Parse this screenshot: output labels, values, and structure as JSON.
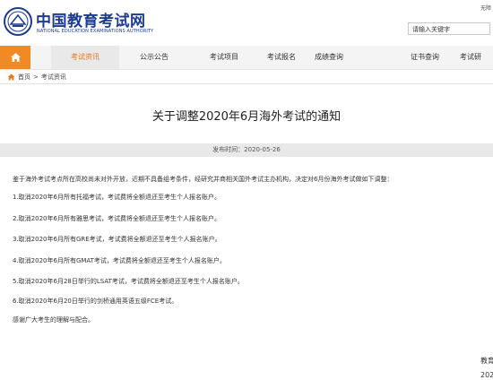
{
  "header": {
    "site_name_cn": "中国教育考试网",
    "site_name_en": "NATIONAL EDUCATION EXAMINATIONS AUTHORITY",
    "top_link": "无障",
    "search_placeholder": "请输入关键字"
  },
  "nav": {
    "home_icon": "home-icon",
    "items": [
      {
        "label": "考试资讯",
        "active": true
      },
      {
        "label": "公示公告",
        "active": false
      },
      {
        "label": "考试项目",
        "active": false
      },
      {
        "label": "考试报名",
        "active": false
      },
      {
        "label": "成绩查询",
        "active": false
      },
      {
        "label": "证书查询",
        "active": false
      },
      {
        "label": "考试研",
        "active": false
      }
    ]
  },
  "breadcrumb": {
    "home": "首页",
    "separator": ">",
    "current": "考试资讯"
  },
  "article": {
    "title": "关于调整2020年6月海外考试的通知",
    "publish_date": "发布时间：2020-05-26",
    "intro": "鉴于海外考试考点所在高校尚未对外开放，近期不具备组考条件，经研究并商相关国外考试主办机构，决定对6月份海外考试做如下调整：",
    "items": [
      "1.取消2020年6月所有托福考试，考试费将全额退还至考生个人报名账户。",
      "2.取消2020年6月所有雅思考试，考试费将全额退还至考生个人报名账户。",
      "3.取消2020年6月所有GRE考试，考试费将全额退还至考生个人报名账户。",
      "4.取消2020年6月所有GMAT考试，考试费将全额退还至考生个人报名账户。",
      "5.取消2020年6月28日举行的LSAT考试，考试费将全额退还至考生个人报名账户。",
      "6.取消2020年6月20日举行的剑桥通用英语五级FCE考试。"
    ],
    "closing": "感谢广大考生的理解与配合。",
    "signature_org": "教育",
    "signature_date": "202"
  },
  "colors": {
    "brand_blue": "#1d3c8f",
    "accent_orange": "#f08a24",
    "active_text": "#e8781e"
  }
}
